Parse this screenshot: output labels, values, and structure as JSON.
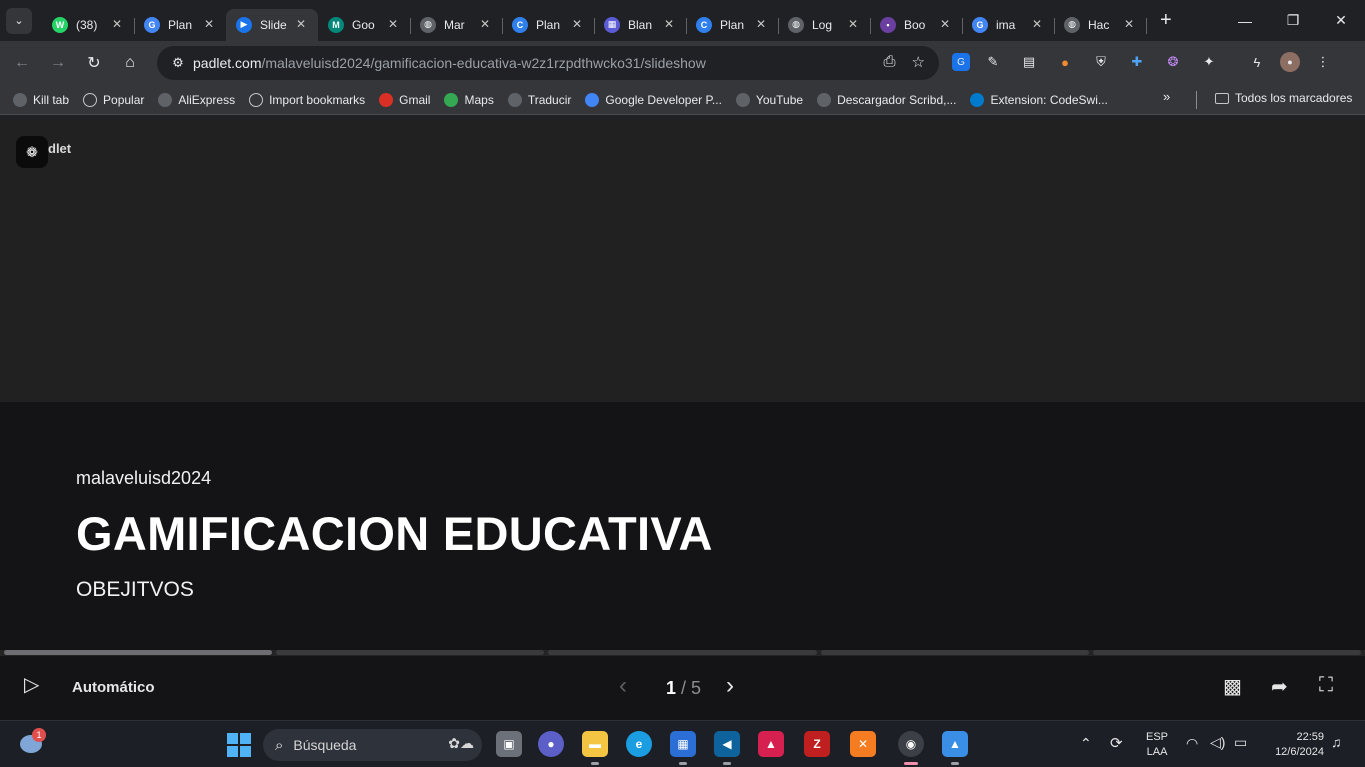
{
  "tabs": [
    {
      "title": "(38)",
      "icon": "whatsapp-icon",
      "color": "#25d366",
      "glyph": "W"
    },
    {
      "title": "Plan",
      "icon": "google-icon",
      "color": "#4285f4",
      "glyph": "G"
    },
    {
      "title": "Slide",
      "icon": "slides-icon",
      "color": "#1a73e8",
      "glyph": "▶",
      "active": true
    },
    {
      "title": "Goo",
      "icon": "meet-icon",
      "color": "#00897b",
      "glyph": "M"
    },
    {
      "title": "Mar",
      "icon": "globe-icon",
      "color": "#5f6368",
      "glyph": "◍"
    },
    {
      "title": "Plan",
      "icon": "canva-icon",
      "color": "#2f80ed",
      "glyph": "C"
    },
    {
      "title": "Blan",
      "icon": "calendar-icon",
      "color": "#5b5bd6",
      "glyph": "▦"
    },
    {
      "title": "Plan",
      "icon": "canva-icon",
      "color": "#2f80ed",
      "glyph": "C"
    },
    {
      "title": "Log",
      "icon": "globe-icon",
      "color": "#5f6368",
      "glyph": "◍"
    },
    {
      "title": "Boo",
      "icon": "site-icon",
      "color": "#6a3fa0",
      "glyph": "▪"
    },
    {
      "title": "ima",
      "icon": "google-icon",
      "color": "#4285f4",
      "glyph": "G"
    },
    {
      "title": "Hac",
      "icon": "globe-icon",
      "color": "#5f6368",
      "glyph": "◍"
    }
  ],
  "tab_close": "✕",
  "new_tab": "+",
  "window": {
    "minimize": "—",
    "restore": "❐",
    "close": "✕"
  },
  "url": {
    "host": "padlet.com",
    "path": "/malaveluisd2024/gamificacion-educativa-w2z1rzpdthwcko31/slideshow"
  },
  "nav": {
    "back": "←",
    "forward": "→",
    "reload": "↻",
    "home": "⌂"
  },
  "bookmarks": [
    {
      "label": "Kill tab",
      "icon": "globe-icon",
      "color": "#5f6368"
    },
    {
      "label": "Popular",
      "icon": "folder-icon",
      "color": "transparent"
    },
    {
      "label": "AliExpress",
      "icon": "globe-icon",
      "color": "#5f6368"
    },
    {
      "label": "Import bookmarks",
      "icon": "gear-icon",
      "color": "transparent"
    },
    {
      "label": "Gmail",
      "icon": "gmail-icon",
      "color": "#d93025"
    },
    {
      "label": "Maps",
      "icon": "maps-icon",
      "color": "#34a853"
    },
    {
      "label": "Traducir",
      "icon": "globe-icon",
      "color": "#5f6368"
    },
    {
      "label": "Google Developer P...",
      "icon": "google-icon",
      "color": "#4285f4"
    },
    {
      "label": "YouTube",
      "icon": "globe-icon",
      "color": "#5f6368"
    },
    {
      "label": "Descargador Scribd,...",
      "icon": "globe-icon",
      "color": "#5f6368"
    },
    {
      "label": "Extension: CodeSwi...",
      "icon": "vscode-icon",
      "color": "#007acc"
    }
  ],
  "bookmarks_more": "»",
  "bookmarks_all": "Todos los marcadores",
  "padlet": {
    "brand": "dlet",
    "author": "malaveluisd2024",
    "title": "GAMIFICACION EDUCATIVA",
    "subtitle": "OBEJITVOS",
    "progress_total": 5,
    "progress_current": 1,
    "auto_label": "Automático",
    "counter_current": "1",
    "counter_sep": " / ",
    "counter_total": "5"
  },
  "taskbar": {
    "search_label": "Búsqueda",
    "notification_count": "1",
    "lang_top": "ESP",
    "lang_bottom": "LAA",
    "time": "22:59",
    "date": "12/6/2024"
  }
}
